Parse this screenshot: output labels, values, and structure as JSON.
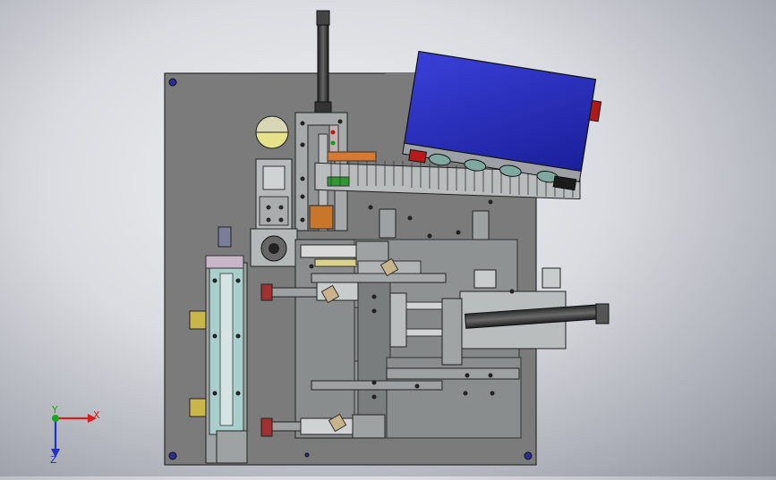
{
  "app": {
    "view": "isometric-top",
    "background": "#cfd2d8"
  },
  "model": {
    "plate_color": "#7c7c7c",
    "part_color": "#a8acac",
    "cylinder_color": "#5a5a5a",
    "blue_box_color": "#2a2fb8",
    "red_accent": "#b51818",
    "teal_color": "#9ec6c4",
    "yellow_color": "#dede6a",
    "orange_color": "#d9782a",
    "green_color": "#2f9a2f"
  },
  "triad": {
    "x_label": "X",
    "y_label": "Y",
    "z_label": "Z",
    "x_color": "#d42020",
    "y_color": "#1aa61a",
    "z_color": "#2030c8"
  }
}
